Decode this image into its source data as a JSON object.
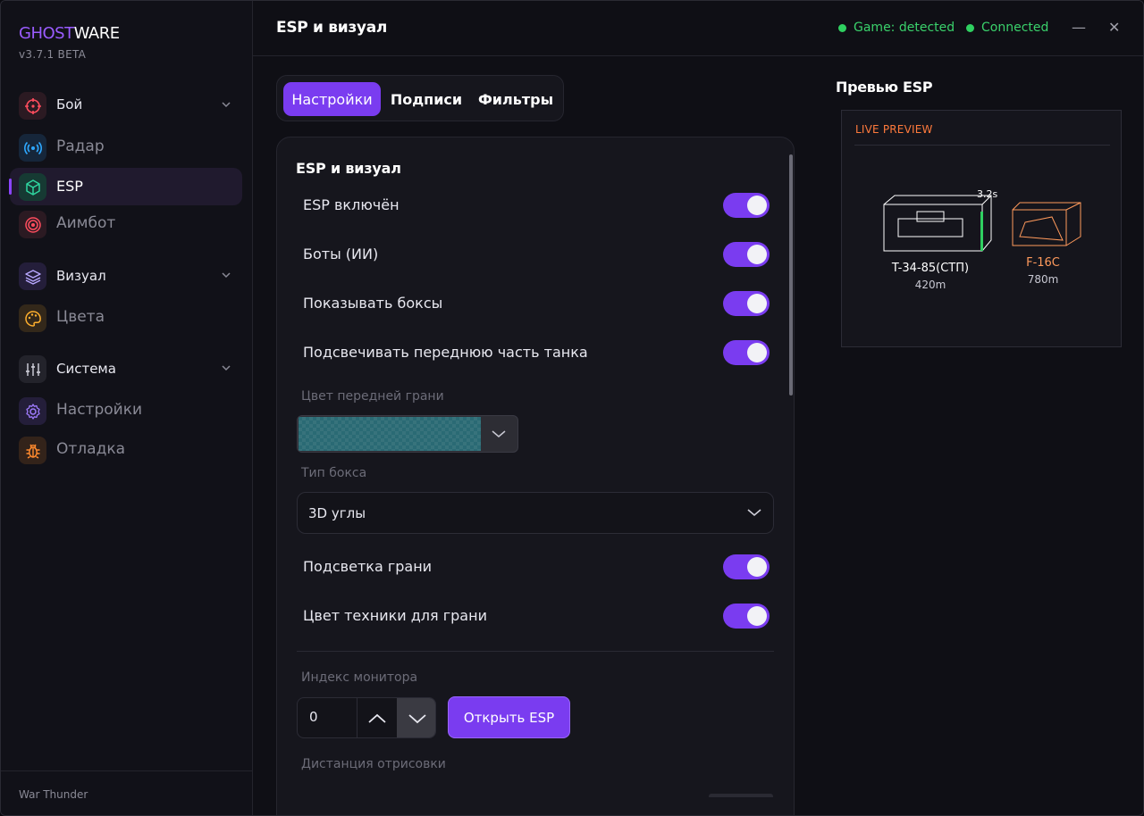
{
  "app": {
    "brand_part1": "GHOST",
    "brand_part2": "WARE",
    "version": "v3.7.1 BETA",
    "footer": "War Thunder"
  },
  "sidebar": {
    "items": [
      {
        "label": "Бой",
        "icon": "crosshair-icon",
        "color": "#ff4d5e",
        "kind": "group"
      },
      {
        "label": "Радар",
        "icon": "radar-icon",
        "color": "#2ea8ff",
        "kind": "sub"
      },
      {
        "label": "ESP",
        "icon": "cube-icon",
        "color": "#2fd6a0",
        "kind": "active"
      },
      {
        "label": "Аимбот",
        "icon": "target-icon",
        "color": "#ff4d5e",
        "kind": "sub"
      },
      {
        "label": "Визуал",
        "icon": "layers-icon",
        "color": "#a07cff",
        "kind": "group"
      },
      {
        "label": "Цвета",
        "icon": "palette-icon",
        "color": "#ffb02e",
        "kind": "sub"
      },
      {
        "label": "Система",
        "icon": "sliders-icon",
        "color": "#c0c0cc",
        "kind": "group"
      },
      {
        "label": "Настройки",
        "icon": "gear-icon",
        "color": "#a07cff",
        "kind": "sub"
      },
      {
        "label": "Отладка",
        "icon": "bug-icon",
        "color": "#ff8a2e",
        "kind": "sub"
      }
    ]
  },
  "header": {
    "title": "ESP и визуал",
    "status_game": "Game: detected",
    "status_conn": "Connected",
    "minimize": "—",
    "close": "✕"
  },
  "tabs": [
    "Настройки",
    "Подписи",
    "Фильтры"
  ],
  "settings": {
    "section_title": "ESP и визуал",
    "toggles": [
      {
        "label": "ESP включён",
        "on": true
      },
      {
        "label": "Боты (ИИ)",
        "on": true
      },
      {
        "label": "Показывать боксы",
        "on": true
      },
      {
        "label": "Подсвечивать переднюю часть танка",
        "on": true
      }
    ],
    "front_color_label": "Цвет передней грани",
    "front_color_value": "#2a6a74",
    "box_type_label": "Тип бокса",
    "box_type_value": "3D углы",
    "toggles2": [
      {
        "label": "Подсветка грани",
        "on": true
      },
      {
        "label": "Цвет техники для грани",
        "on": true
      }
    ],
    "monitor_label": "Индекс монитора",
    "monitor_value": "0",
    "open_button": "Открыть ESP",
    "distance_label": "Дистанция отрисовки"
  },
  "preview": {
    "title": "Превью ESP",
    "live_label": "LIVE PREVIEW",
    "targets": [
      {
        "name": "T-34-85(СТП)",
        "distance": "420m",
        "timer": "3.2s",
        "color": "#ffffff"
      },
      {
        "name": "F-16C",
        "distance": "780m",
        "color": "#ff9a5c"
      }
    ]
  },
  "colors": {
    "accent": "#7a3cf0",
    "status_green": "#2fd060",
    "live_orange": "#ff7a3c"
  }
}
